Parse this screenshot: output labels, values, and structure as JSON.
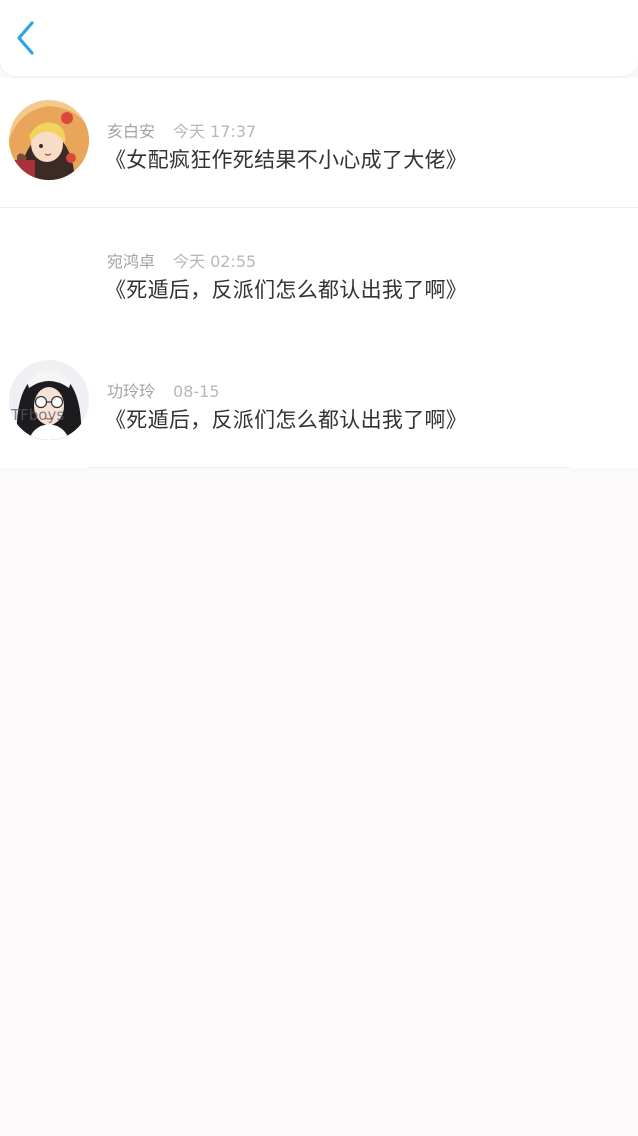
{
  "header": {
    "back_icon": "chevron-left-icon",
    "accent_color": "#2ea3e6"
  },
  "messages": [
    {
      "name": "亥白安",
      "time": "今天 17:37",
      "title": "《女配疯狂作死结果不小心成了大佬》",
      "avatar": "anime-girl-avatar"
    },
    {
      "name": "宛鸿卓",
      "time": "今天 02:55",
      "title": "《死遁后，反派们怎么都认出我了啊》",
      "avatar": "blank-avatar"
    },
    {
      "name": "功玲玲",
      "time": "08-15",
      "title": "《死遁后，反派们怎么都认出我了啊》",
      "avatar": "girl-photo-avatar",
      "avatar_overlay_text": "TFboys"
    }
  ]
}
